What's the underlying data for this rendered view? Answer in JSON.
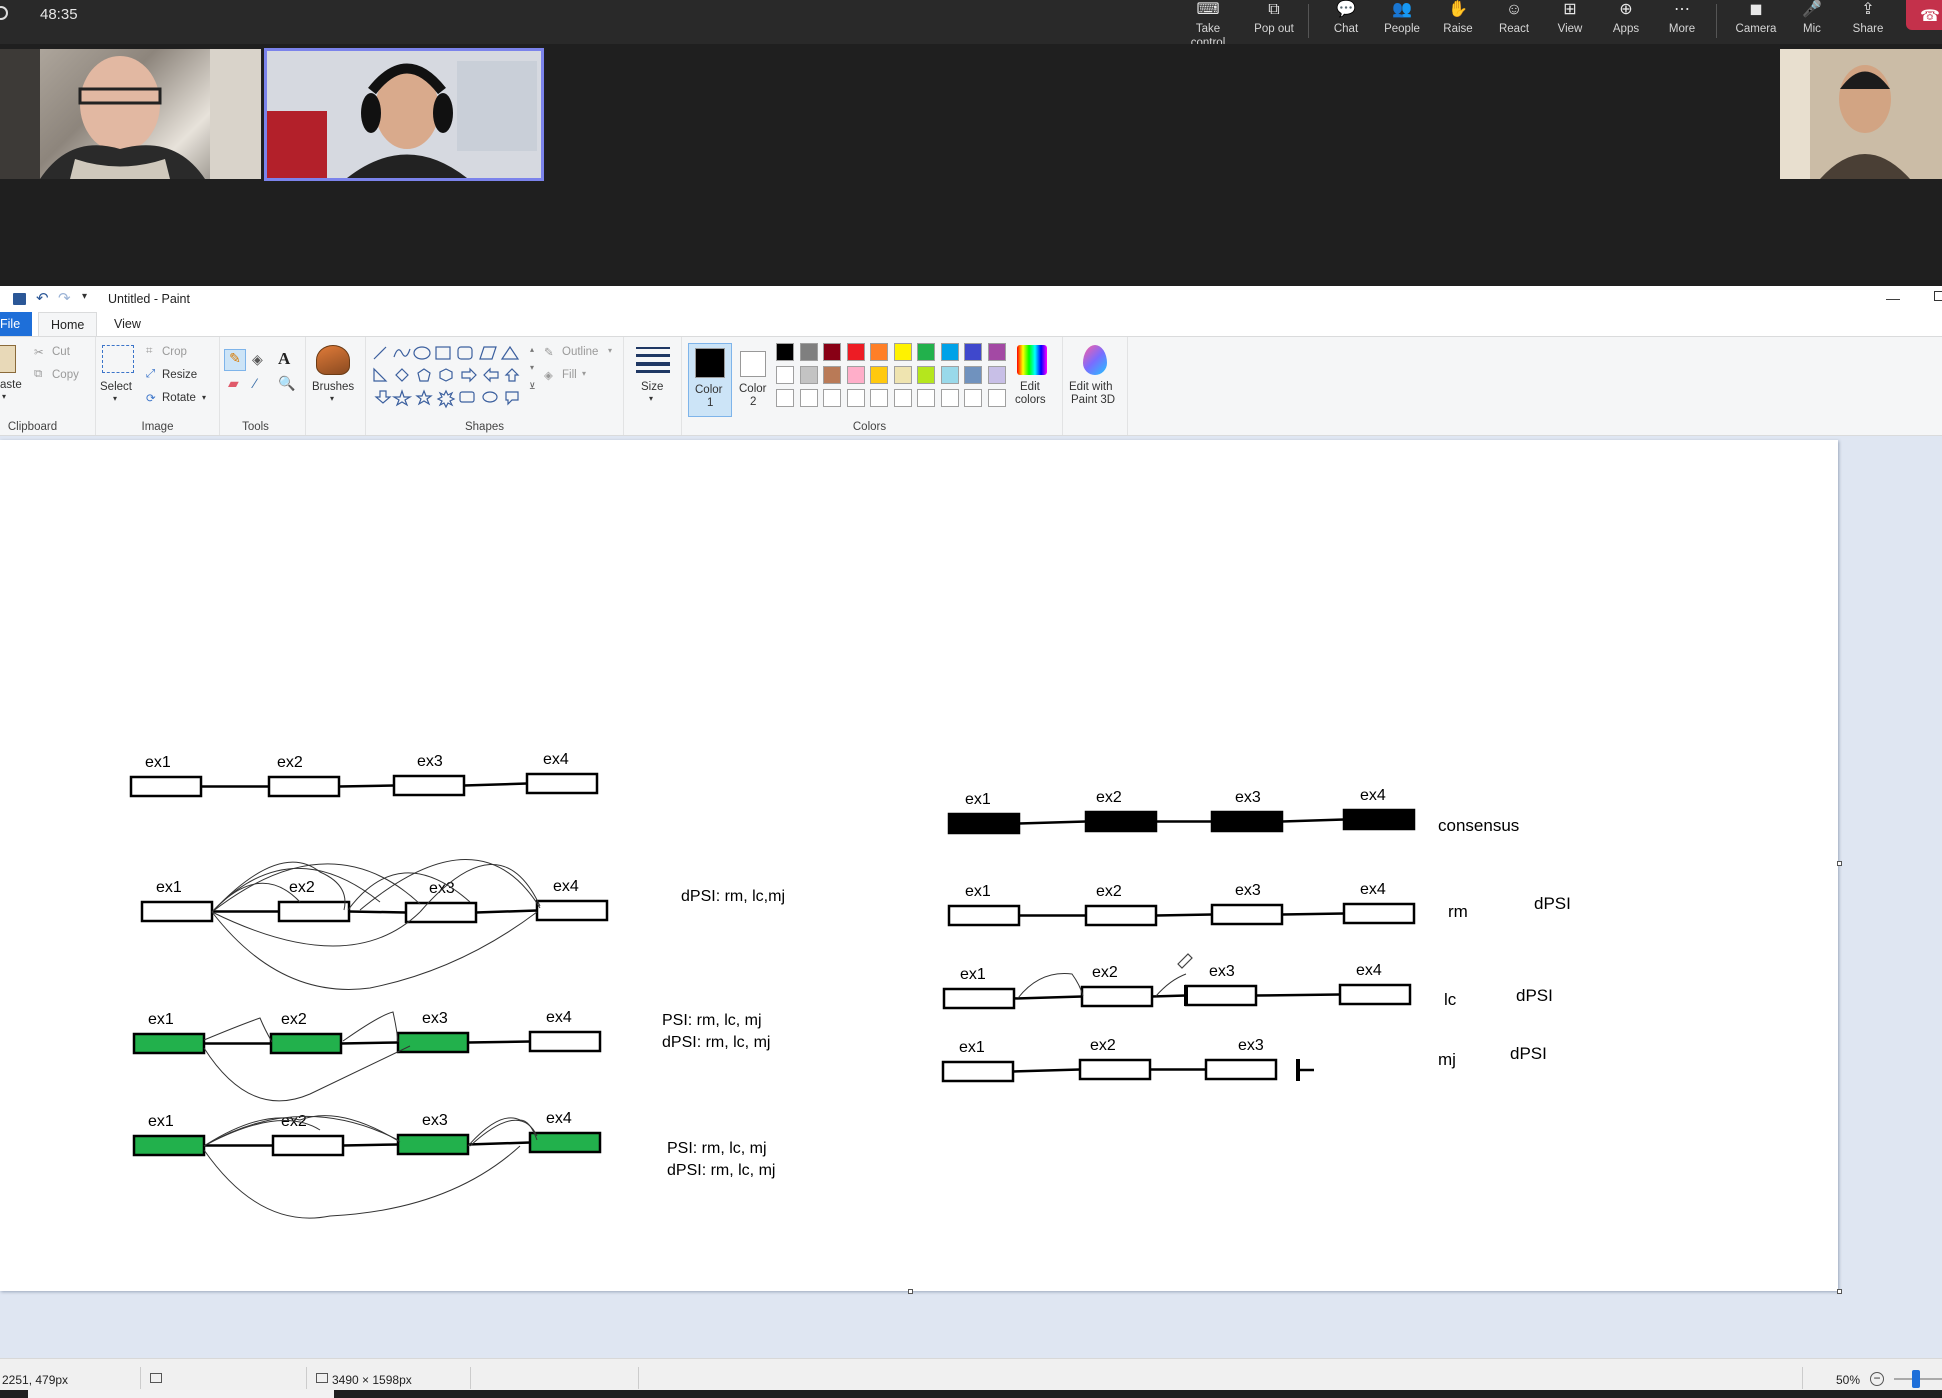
{
  "meeting": {
    "timer": "48:35",
    "toolbar": [
      {
        "label": "Take control",
        "icon": "take-control-icon"
      },
      {
        "label": "Pop out",
        "icon": "pop-out-icon"
      },
      {
        "label": "Chat",
        "icon": "chat-icon"
      },
      {
        "label": "People",
        "icon": "people-icon"
      },
      {
        "label": "Raise",
        "icon": "raise-hand-icon"
      },
      {
        "label": "React",
        "icon": "react-icon"
      },
      {
        "label": "View",
        "icon": "view-icon"
      },
      {
        "label": "Apps",
        "icon": "apps-icon"
      },
      {
        "label": "More",
        "icon": "more-icon"
      },
      {
        "label": "Camera",
        "icon": "camera-icon"
      },
      {
        "label": "Mic",
        "icon": "mic-icon"
      },
      {
        "label": "Share",
        "icon": "share-icon"
      }
    ]
  },
  "paint": {
    "title": "Untitled - Paint",
    "menu": {
      "file": "File",
      "home": "Home",
      "view": "View"
    },
    "clipboard": {
      "paste": "aste",
      "cut": "Cut",
      "copy": "Copy",
      "group": "Clipboard"
    },
    "image": {
      "select": "Select",
      "crop": "Crop",
      "resize": "Resize",
      "rotate": "Rotate",
      "group": "Image"
    },
    "tools": {
      "group": "Tools",
      "text_tool": "A"
    },
    "brushes": {
      "label": "Brushes"
    },
    "shapes": {
      "outline": "Outline",
      "fill": "Fill",
      "group": "Shapes"
    },
    "size": {
      "label": "Size"
    },
    "colors": {
      "color1_label": "Color",
      "color1_num": "1",
      "color2_label": "Color",
      "color2_num": "2",
      "group": "Colors",
      "edit_line1": "Edit",
      "edit_line2": "colors",
      "paint3d_line1": "Edit with",
      "paint3d_line2": "Paint 3D",
      "palette_row1": [
        "#000000",
        "#7f7f7f",
        "#880015",
        "#ed1c24",
        "#ff7f27",
        "#fff200",
        "#22b14c",
        "#00a2e8",
        "#3f48cc",
        "#a349a4"
      ],
      "palette_row2": [
        "#ffffff",
        "#c3c3c3",
        "#b97a57",
        "#ffaec9",
        "#ffc90e",
        "#efe4b0",
        "#b5e61d",
        "#99d9ea",
        "#7092be",
        "#c8bfe7"
      ]
    },
    "status": {
      "cursor": "2251, 479px",
      "dimensions": "3490 × 1598px",
      "zoom": "50%"
    }
  },
  "drawing": {
    "exons": [
      "ex1",
      "ex2",
      "ex3",
      "ex4"
    ],
    "left_notes": {
      "row2": "dPSI: rm, lc,mj",
      "row3_psi": "PSI: rm, lc, mj",
      "row3_dpsi": "dPSI: rm, lc, mj",
      "row4_psi": "PSI: rm, lc, mj",
      "row4_dpsi": "dPSI: rm, lc, mj"
    },
    "right_labels": {
      "consensus": "consensus",
      "rm": "rm",
      "lc": "lc",
      "mj": "mj",
      "dpsi": "dPSI"
    },
    "colors": {
      "green": "#22b14c",
      "black": "#000000"
    }
  }
}
